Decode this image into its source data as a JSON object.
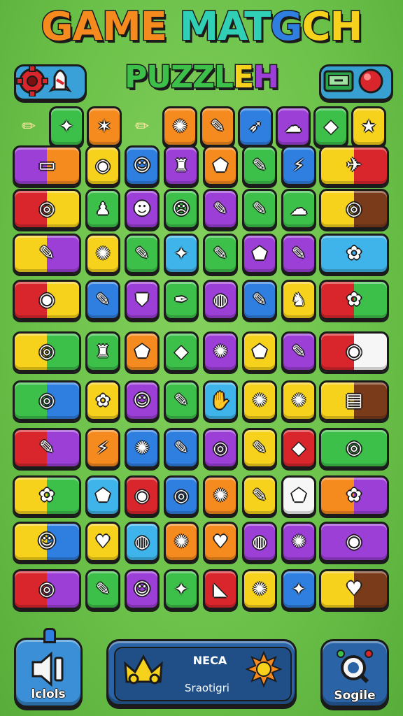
{
  "title": {
    "line1": [
      "GAME ",
      "MAT",
      "G",
      "CH"
    ],
    "line2": [
      "PUZZL",
      "E",
      "H"
    ]
  },
  "colors": {
    "orange": "#f58a1f",
    "teal": "#2fd0b5",
    "blue": "#2f7fe0",
    "yellow": "#f7d21c",
    "green": "#3cc04a",
    "purple": "#9b3fd6",
    "red": "#d8262c",
    "lightblue": "#3fb4ea",
    "darkgreen": "#2e9a3a",
    "white": "#f6f6f6",
    "brown": "#7a3b1a"
  },
  "header": {
    "left_icon": "gear-icon",
    "left_icon2": "rocket-icon",
    "right_icon": "console-icon",
    "right_icon2": "red-button-icon"
  },
  "board": {
    "rows": [
      [
        [
          "none",
          "✏"
        ],
        [
          "green",
          "✦"
        ],
        [
          "orange",
          "✶"
        ],
        [
          "none",
          "✏"
        ],
        [
          "orange",
          "✺"
        ],
        [
          "orange",
          "✎"
        ],
        [
          "blue",
          "➶"
        ],
        [
          "purple",
          "☁"
        ],
        [
          "green",
          "◆"
        ],
        [
          "yellow",
          "★"
        ]
      ],
      [
        [
          "purple|orange",
          "▭"
        ],
        [
          "yellow",
          "◉"
        ],
        [
          "blue",
          "☺"
        ],
        [
          "purple",
          "♜"
        ],
        [
          "orange",
          "⬟"
        ],
        [
          "green",
          "✎"
        ],
        [
          "blue",
          "⚡"
        ],
        [
          "yellow|red",
          "✈"
        ]
      ],
      [
        [
          "red|yellow",
          "◎"
        ],
        [
          "green",
          "♟"
        ],
        [
          "purple",
          "☻"
        ],
        [
          "green",
          "☹"
        ],
        [
          "purple",
          "✎"
        ],
        [
          "green",
          "✎"
        ],
        [
          "green",
          "☁"
        ],
        [
          "yellow|brown",
          "◎"
        ]
      ],
      [
        [
          "yellow|purple",
          "✎"
        ],
        [
          "yellow",
          "✺"
        ],
        [
          "green",
          "✎"
        ],
        [
          "lightblue",
          "✦"
        ],
        [
          "green",
          "✎"
        ],
        [
          "purple",
          "⬟"
        ],
        [
          "purple",
          "✎"
        ],
        [
          "lightblue",
          "✿"
        ]
      ],
      [
        [
          "red|yellow",
          "◉"
        ],
        [
          "blue",
          "✎"
        ],
        [
          "purple",
          "⛊"
        ],
        [
          "green",
          "✒"
        ],
        [
          "purple",
          "◍"
        ],
        [
          "blue",
          "✎"
        ],
        [
          "yellow",
          "♞"
        ],
        [
          "red|green",
          "✿"
        ]
      ],
      [
        [
          "yellow|green",
          "◎"
        ],
        [
          "green",
          "♜"
        ],
        [
          "orange",
          "⬟"
        ],
        [
          "green",
          "◆"
        ],
        [
          "purple",
          "✺"
        ],
        [
          "yellow",
          "⬟"
        ],
        [
          "purple",
          "✎"
        ],
        [
          "red|white",
          "◉"
        ]
      ],
      [
        [
          "green|blue",
          "◎"
        ],
        [
          "yellow",
          "✿"
        ],
        [
          "purple",
          "☺"
        ],
        [
          "green",
          "✎"
        ],
        [
          "lightblue",
          "✋"
        ],
        [
          "yellow",
          "✺"
        ],
        [
          "yellow",
          "✺"
        ],
        [
          "yellow|brown",
          "▤"
        ]
      ],
      [
        [
          "red|purple",
          "✎"
        ],
        [
          "orange",
          "⚡"
        ],
        [
          "blue",
          "✺"
        ],
        [
          "blue",
          "✎"
        ],
        [
          "purple",
          "◎"
        ],
        [
          "yellow",
          "✎"
        ],
        [
          "red",
          "◆"
        ],
        [
          "green",
          "◎"
        ]
      ],
      [
        [
          "yellow|green",
          "✿"
        ],
        [
          "lightblue",
          "⬟"
        ],
        [
          "red",
          "◉"
        ],
        [
          "blue",
          "◎"
        ],
        [
          "orange",
          "✺"
        ],
        [
          "yellow",
          "✎"
        ],
        [
          "white",
          "⬟"
        ],
        [
          "orange|purple",
          "✿"
        ]
      ],
      [
        [
          "yellow|blue",
          "☺"
        ],
        [
          "yellow",
          "♥"
        ],
        [
          "lightblue",
          "◍"
        ],
        [
          "orange",
          "✺"
        ],
        [
          "orange",
          "♥"
        ],
        [
          "purple",
          "◍"
        ],
        [
          "purple",
          "✺"
        ],
        [
          "purple",
          "◉"
        ]
      ],
      [
        [
          "red|purple",
          "◎"
        ],
        [
          "green",
          "✎"
        ],
        [
          "purple",
          "☺"
        ],
        [
          "green",
          "✦"
        ],
        [
          "red",
          "◣"
        ],
        [
          "yellow",
          "✺"
        ],
        [
          "blue",
          "✦"
        ],
        [
          "yellow|brown",
          "♥"
        ]
      ]
    ]
  },
  "bottom": {
    "left_label": "lclols",
    "center_title": "NECA",
    "center_sub": "Sraotigri",
    "right_label": "Sogile",
    "left_icon": "speaker-icon",
    "center_icons": [
      "crown-icon",
      "sun-icon"
    ],
    "right_icon": "search-icon"
  }
}
